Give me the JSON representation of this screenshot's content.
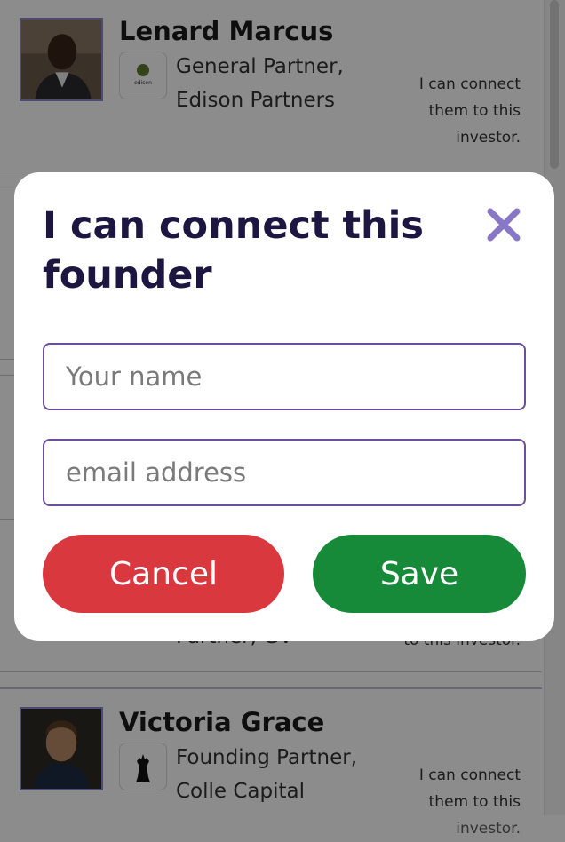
{
  "profiles": [
    {
      "name": "Lenard Marcus",
      "role": "General Partner, Edison Partners",
      "connect_note": "I can connect them to this investor.",
      "logo_text": "edison"
    },
    {
      "name": "",
      "role": "Partner, GV",
      "connect_note": "to this investor."
    },
    {
      "name": "Victoria Grace",
      "role": "Founding Partner, Colle Capital",
      "connect_note": "I can connect them to this investor."
    }
  ],
  "modal": {
    "title": "I can connect this founder",
    "name_placeholder": "Your name",
    "email_placeholder": "email address",
    "cancel_label": "Cancel",
    "save_label": "Save",
    "close_icon": "close-icon"
  },
  "colors": {
    "title": "#1c1640",
    "close_icon": "#8877c4",
    "field_border": "#6b4f9c",
    "cancel": "#d9383f",
    "save": "#178a3a"
  }
}
